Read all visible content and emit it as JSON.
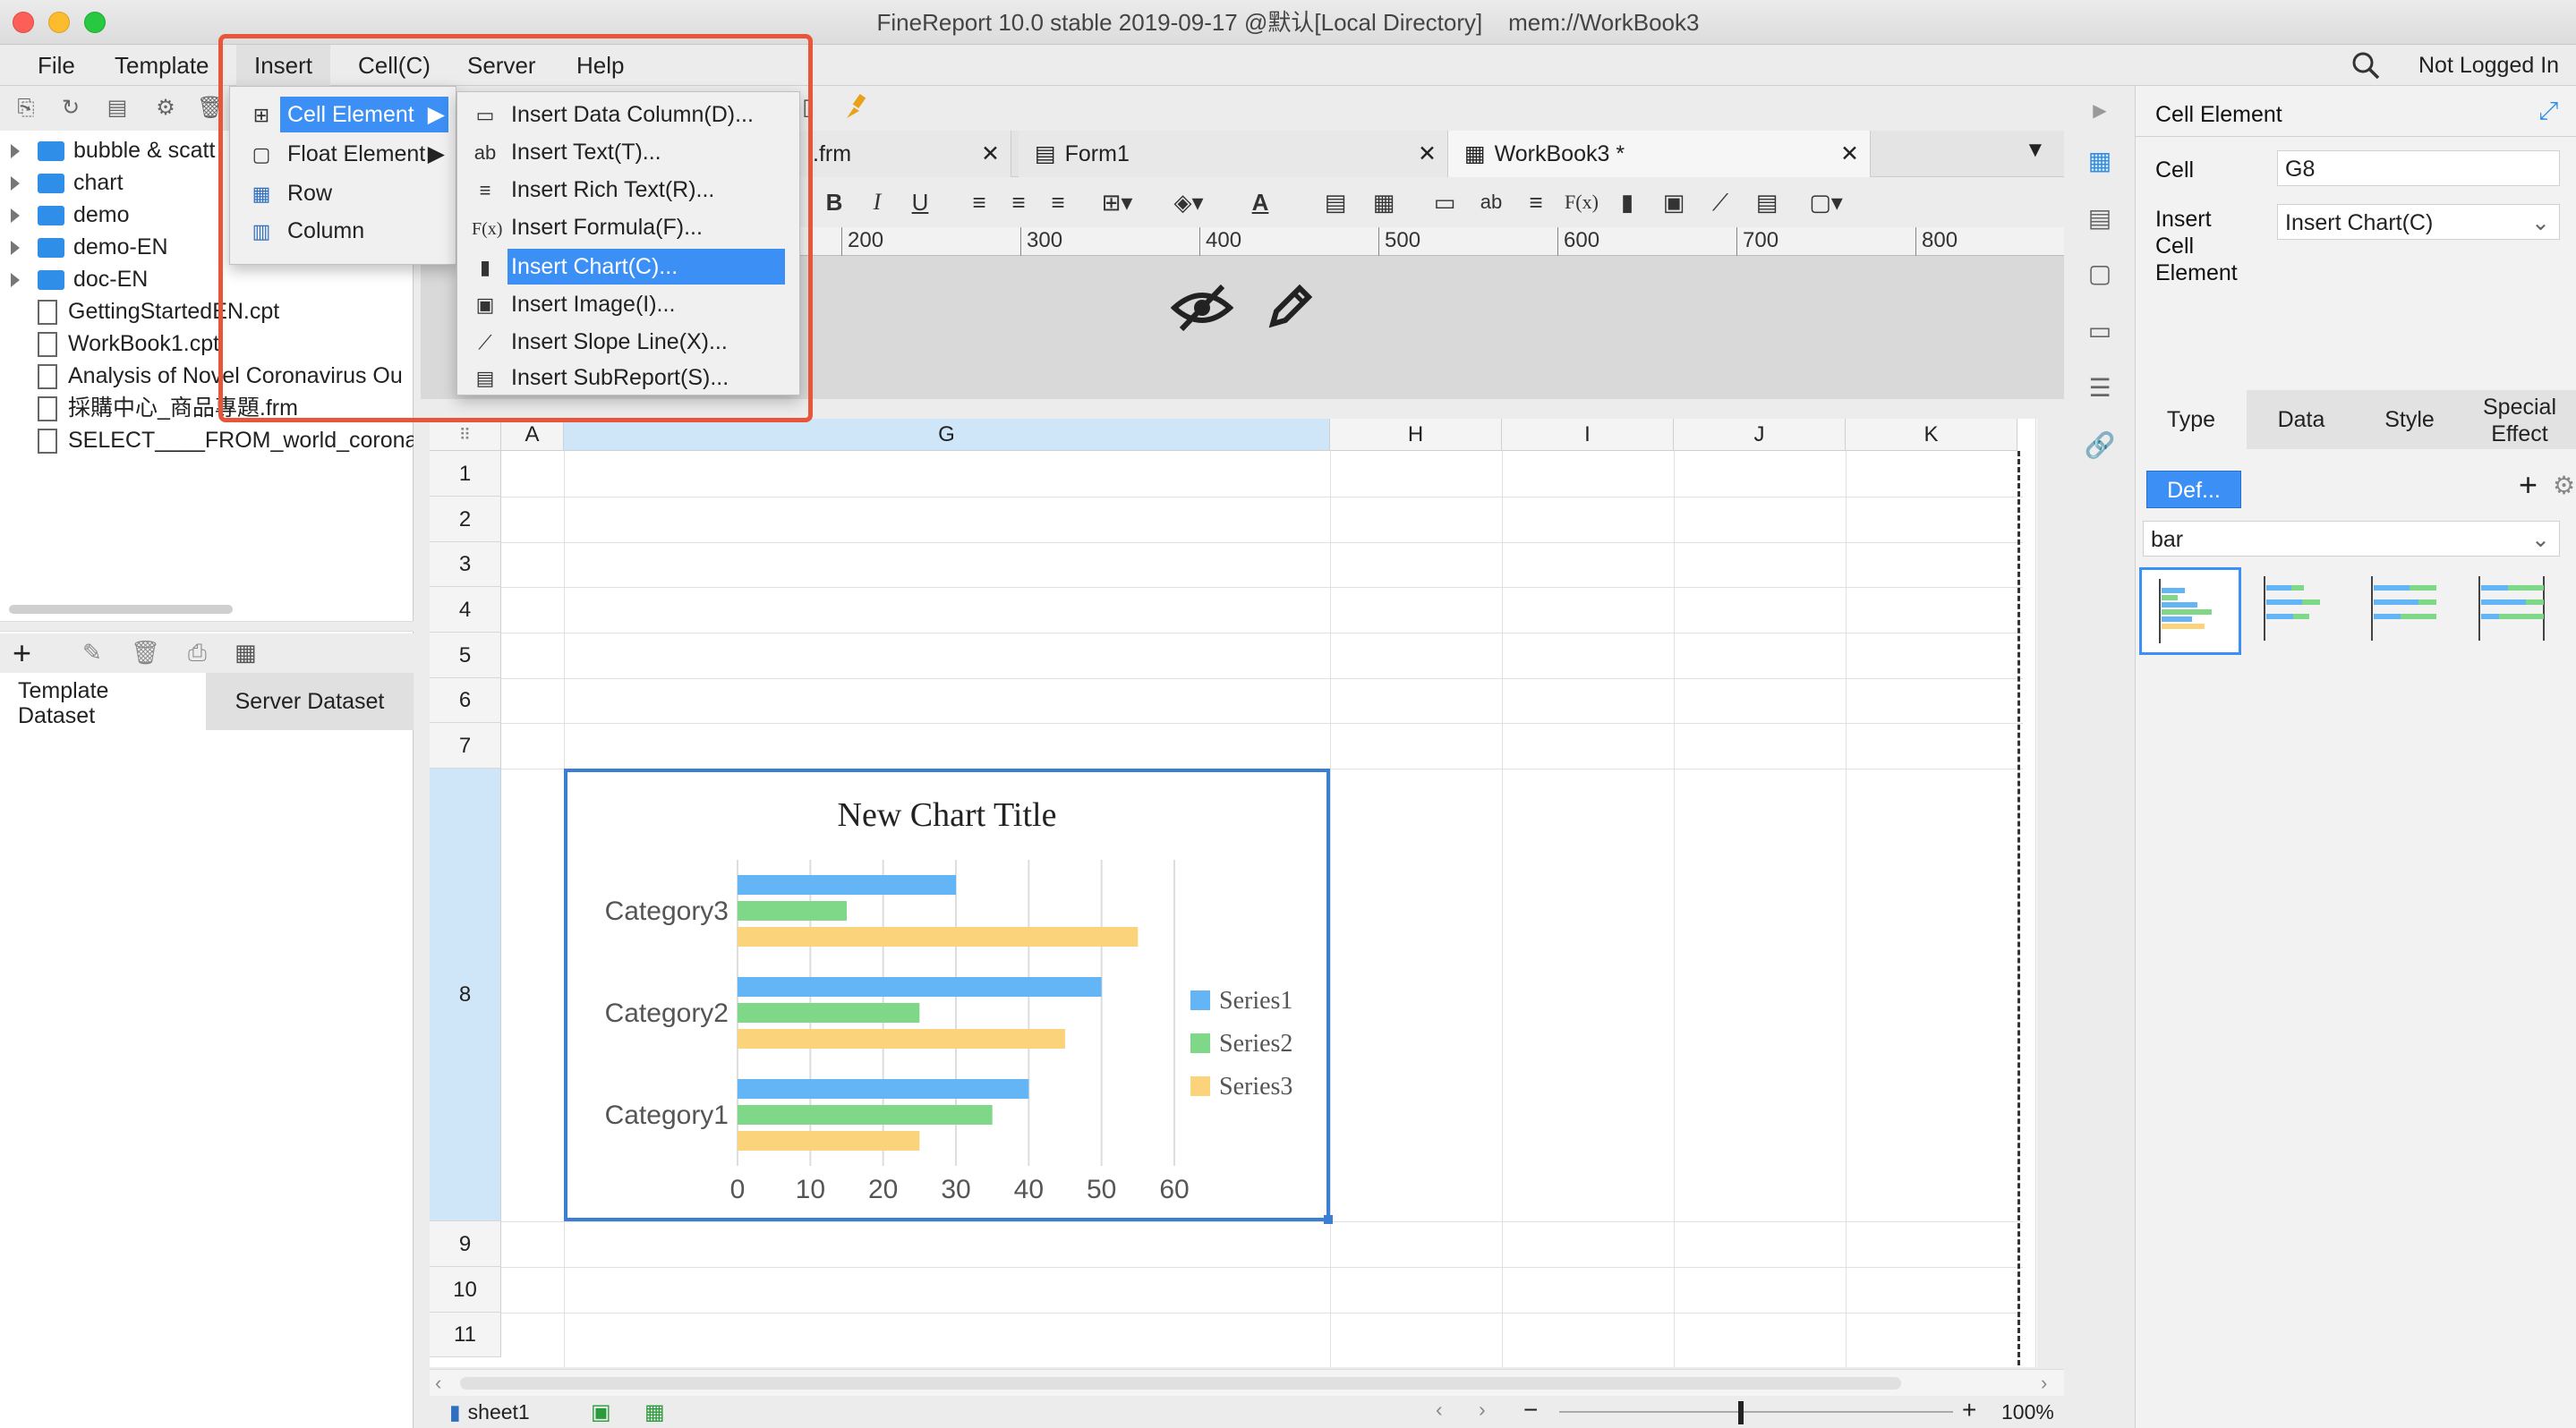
{
  "window": {
    "title": "FineReport 10.0 stable 2019-09-17 @默认[Local Directory]    mem://WorkBook3"
  },
  "menubar": {
    "items": [
      "File",
      "Template",
      "Insert",
      "Cell(C)",
      "Server",
      "Help"
    ],
    "active": "Insert",
    "login": "Not Logged In"
  },
  "insert_menu": {
    "items": [
      "Cell Element",
      "Float Element",
      "Row",
      "Column"
    ],
    "submenu": [
      "Insert Data Column(D)...",
      "Insert Text(T)...",
      "Insert Rich Text(R)...",
      "Insert Formula(F)...",
      "Insert Chart(C)...",
      "Insert Image(I)...",
      "Insert Slope Line(X)...",
      "Insert SubReport(S)..."
    ],
    "submenu_icons": [
      "▭",
      "ab",
      "≡",
      "F(x)",
      "▮",
      "▣",
      "⟋",
      "▤"
    ],
    "selected_item": "Cell Element",
    "selected_subitem": "Insert Chart(C)..."
  },
  "file_tree": {
    "items": [
      {
        "type": "folder",
        "name": "bubble & scatt"
      },
      {
        "type": "folder",
        "name": "chart"
      },
      {
        "type": "folder",
        "name": "demo"
      },
      {
        "type": "folder",
        "name": "demo-EN"
      },
      {
        "type": "folder",
        "name": "doc-EN"
      },
      {
        "type": "file",
        "name": "GettingStartedEN.cpt"
      },
      {
        "type": "file",
        "name": "WorkBook1.cpt"
      },
      {
        "type": "file",
        "name": "Analysis of Novel Coronavirus Ou"
      },
      {
        "type": "file",
        "name": "採購中心_商品專題.frm"
      },
      {
        "type": "file",
        "name": "SELECT____FROM_world_corona_v"
      }
    ]
  },
  "dataset_tabs": {
    "template": "Template\nDataset",
    "server": "Server Dataset"
  },
  "doc_tabs": [
    {
      "label": ".frm"
    },
    {
      "label": "Form1"
    },
    {
      "label": "WorkBook3 *"
    }
  ],
  "ruler": {
    "marks": [
      "200",
      "300",
      "400",
      "500",
      "600",
      "700",
      "800"
    ]
  },
  "format_bar": {
    "bold": "B",
    "italic": "I",
    "underline": "U",
    "font_color": "A",
    "text": "ab",
    "formula": "F(x)"
  },
  "grid": {
    "columns": [
      "A",
      "G",
      "H",
      "I",
      "J",
      "K"
    ],
    "rows": [
      "1",
      "2",
      "3",
      "4",
      "5",
      "6",
      "7",
      "8",
      "9",
      "10",
      "11"
    ]
  },
  "chart_data": {
    "type": "bar",
    "orientation": "horizontal",
    "title": "New Chart Title",
    "categories": [
      "Category1",
      "Category2",
      "Category3"
    ],
    "series": [
      {
        "name": "Series1",
        "color": "#64b5f6",
        "values": [
          40,
          50,
          30
        ]
      },
      {
        "name": "Series2",
        "color": "#7ed887",
        "values": [
          35,
          25,
          15
        ]
      },
      {
        "name": "Series3",
        "color": "#fbd37a",
        "values": [
          25,
          45,
          55
        ]
      }
    ],
    "xlim": [
      0,
      60
    ],
    "xticks": [
      "0",
      "10",
      "20",
      "30",
      "40",
      "50",
      "60"
    ],
    "legend": "right",
    "grid": true
  },
  "right_panel": {
    "header": "Cell Element",
    "cell_label": "Cell",
    "cell_value": "G8",
    "insert_label": "Insert\nCell\nElement",
    "insert_value": "Insert Chart(C)",
    "tabs": [
      "Type",
      "Data",
      "Style",
      "Special\nEffect"
    ],
    "default_button": "Def...",
    "chart_type": "bar"
  },
  "status_bar": {
    "sheet": "sheet1",
    "zoom": "100%"
  },
  "colors": {
    "accent": "#2f8fe8",
    "menu_highlight": "#3b8ff5",
    "annotation": "#e8553a",
    "selection": "#3a7fd4"
  }
}
